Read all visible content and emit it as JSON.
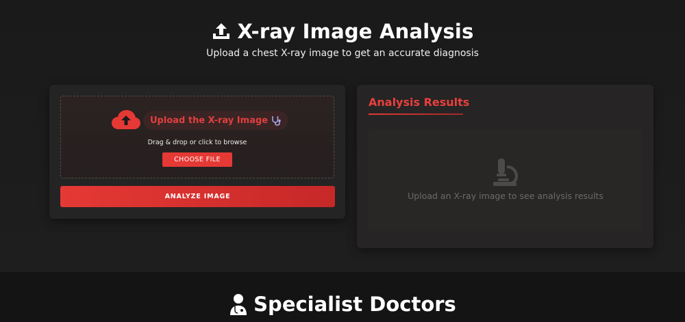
{
  "header": {
    "title": "X-ray Image Analysis",
    "subtitle": "Upload a chest X-ray image to get an accurate diagnosis",
    "icon": "upload-icon"
  },
  "upload": {
    "label": "Upload the X-ray Image",
    "hint": "Drag & drop or click to browse",
    "choose_button": "CHOOSE FILE",
    "analyze_button": "ANALYZE IMAGE",
    "icons": [
      "cloud-upload-icon",
      "stethoscope-icon"
    ]
  },
  "results": {
    "title": "Analysis Results",
    "placeholder": "Upload an X-ray image to see analysis results",
    "icon": "microscope-icon"
  },
  "doctors": {
    "title": "Specialist Doctors",
    "icon": "doctor-icon"
  },
  "colors": {
    "accent": "#e53935",
    "background": "#1b1b1b",
    "card": "#242424"
  }
}
